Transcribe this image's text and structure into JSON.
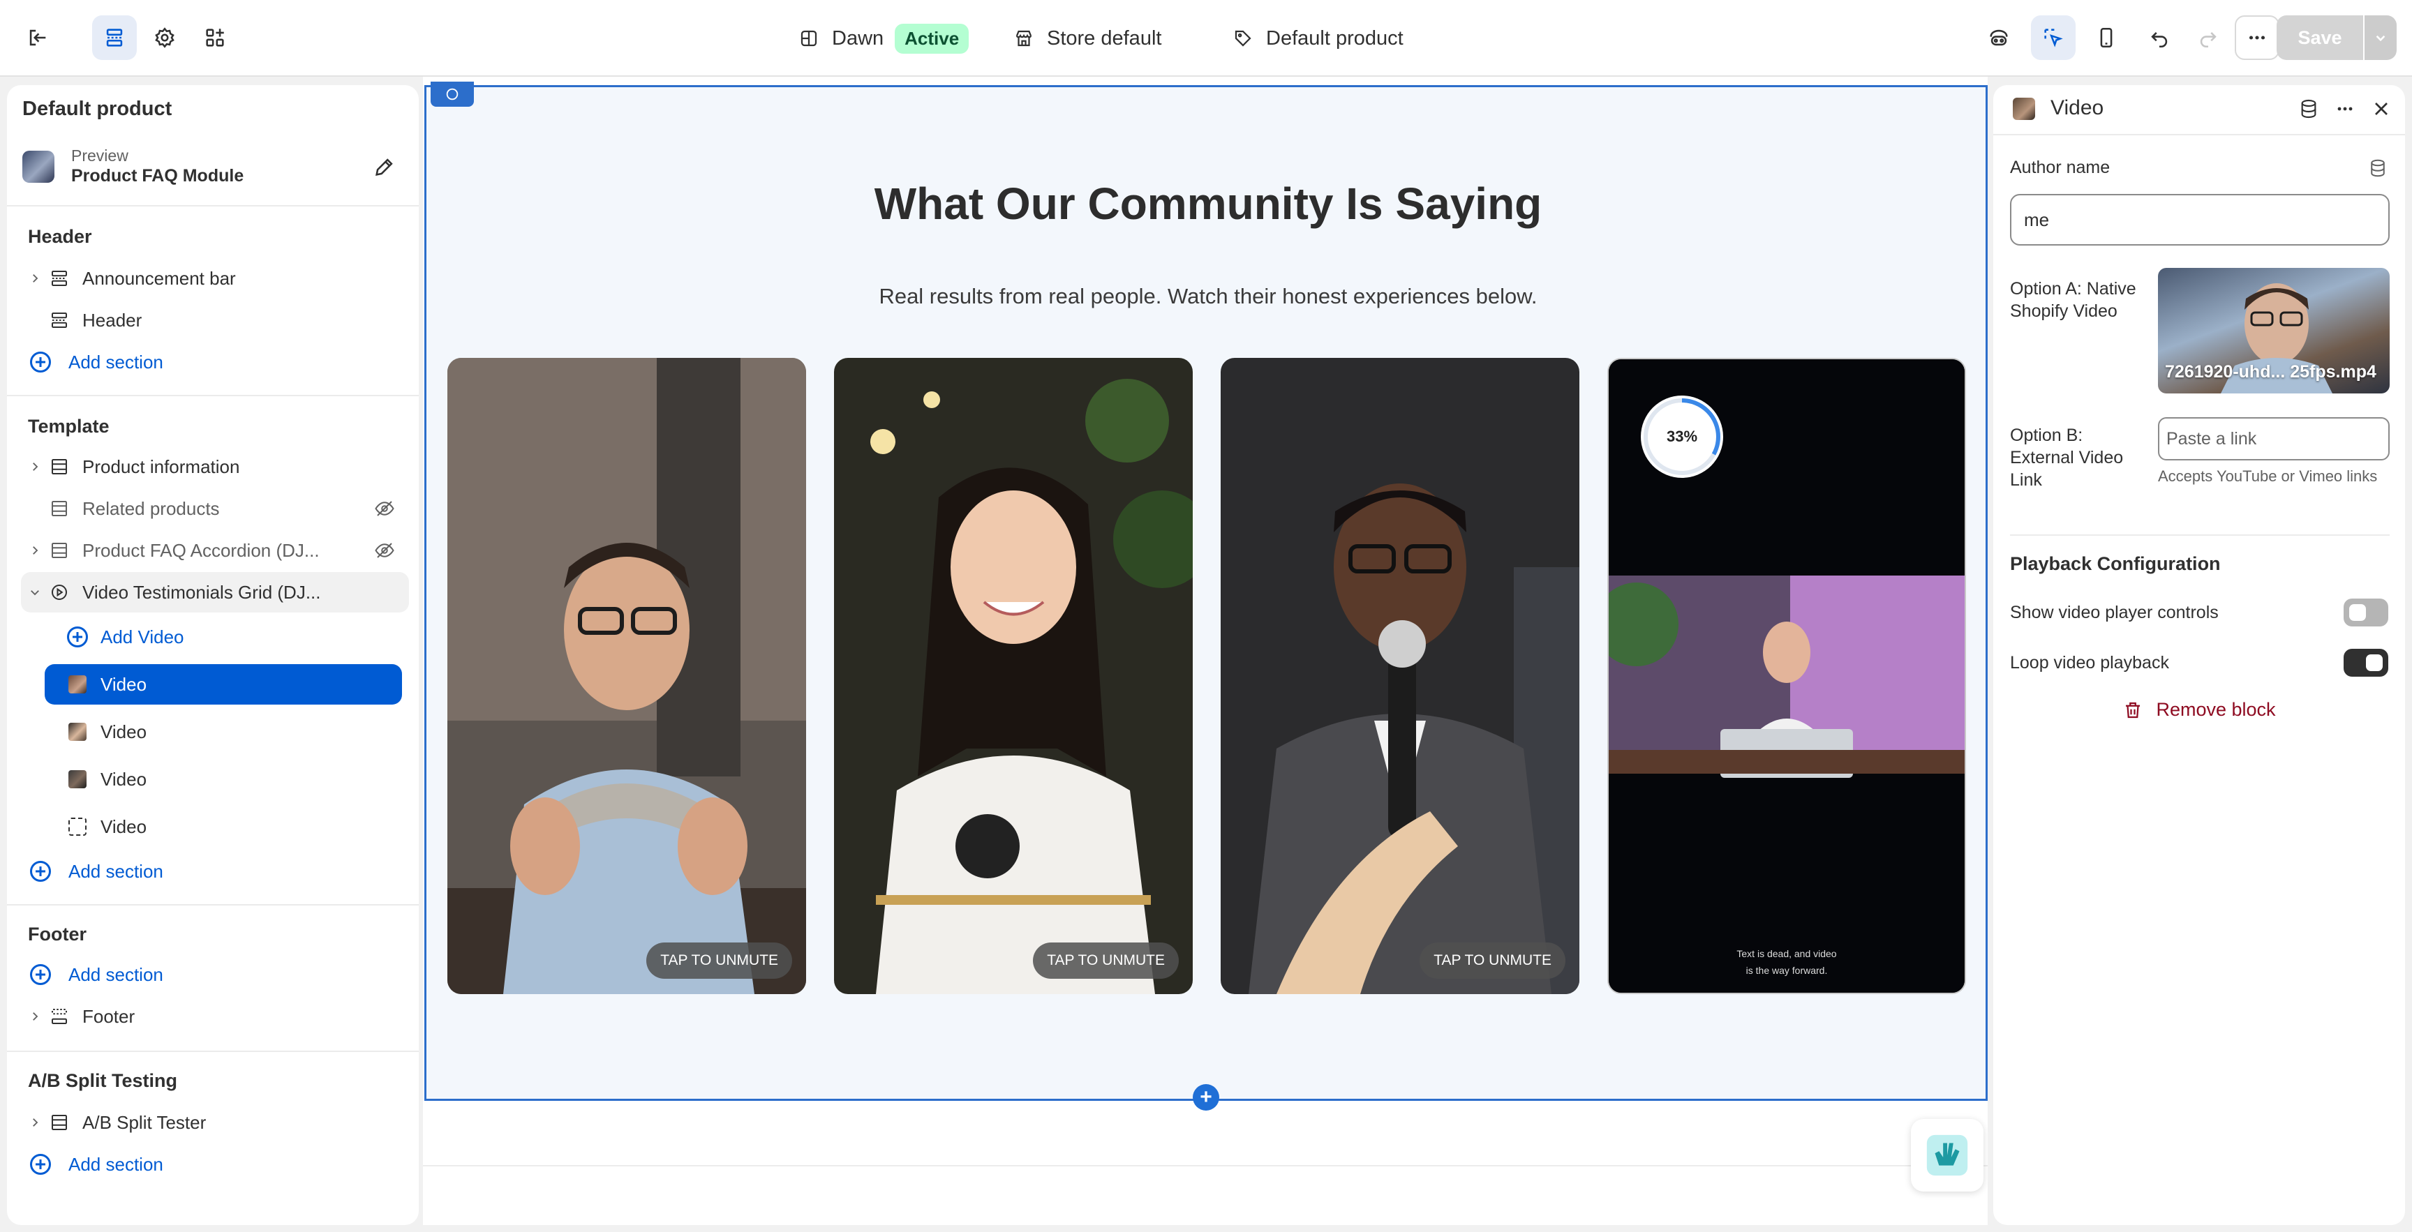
{
  "topbar": {
    "theme_name": "Dawn",
    "theme_status": "Active",
    "store_label": "Store default",
    "product_label": "Default product",
    "save_label": "Save"
  },
  "sidebar": {
    "title": "Default product",
    "preview_label": "Preview",
    "preview_value": "Product FAQ Module",
    "groups": {
      "header": {
        "title": "Header",
        "items": [
          "Announcement bar",
          "Header"
        ],
        "add_label": "Add section"
      },
      "template": {
        "title": "Template",
        "items": [
          "Product information",
          "Related products",
          "Product FAQ Accordion (DJ...",
          "Video Testimonials Grid (DJ..."
        ],
        "add_video_label": "Add Video",
        "blocks": [
          "Video",
          "Video",
          "Video",
          "Video"
        ],
        "add_label": "Add section"
      },
      "footer": {
        "title": "Footer",
        "add_label": "Add section",
        "items": [
          "Footer"
        ]
      },
      "ab": {
        "title": "A/B Split Testing",
        "items": [
          "A/B Split Tester"
        ],
        "add_label": "Add section"
      }
    }
  },
  "canvas": {
    "heading": "What Our Community Is Saying",
    "subheading": "Real results from real people. Watch their honest experiences below.",
    "tap_label": "TAP TO UNMUTE",
    "progress_text": "33%",
    "progress_value": 0.33,
    "caption_line1": "Text is dead, and video",
    "caption_line2": "is the way forward."
  },
  "rpanel": {
    "title": "Video",
    "author_label": "Author name",
    "author_value": "me",
    "option_a_label": "Option A: Native Shopify Video",
    "file_name": "7261920-uhd... 25fps.mp4",
    "option_b_label": "Option B: External Video Link",
    "link_placeholder": "Paste a link",
    "link_help": "Accepts YouTube or Vimeo links",
    "playback_title": "Playback Configuration",
    "controls_label": "Show video player controls",
    "controls_on": false,
    "loop_label": "Loop video playback",
    "loop_on": true,
    "remove_label": "Remove block"
  },
  "colors": {
    "accent": "#005bd3",
    "frame": "#2c6ecb",
    "badge_bg": "#b4fed2",
    "danger": "#8e0b21"
  }
}
